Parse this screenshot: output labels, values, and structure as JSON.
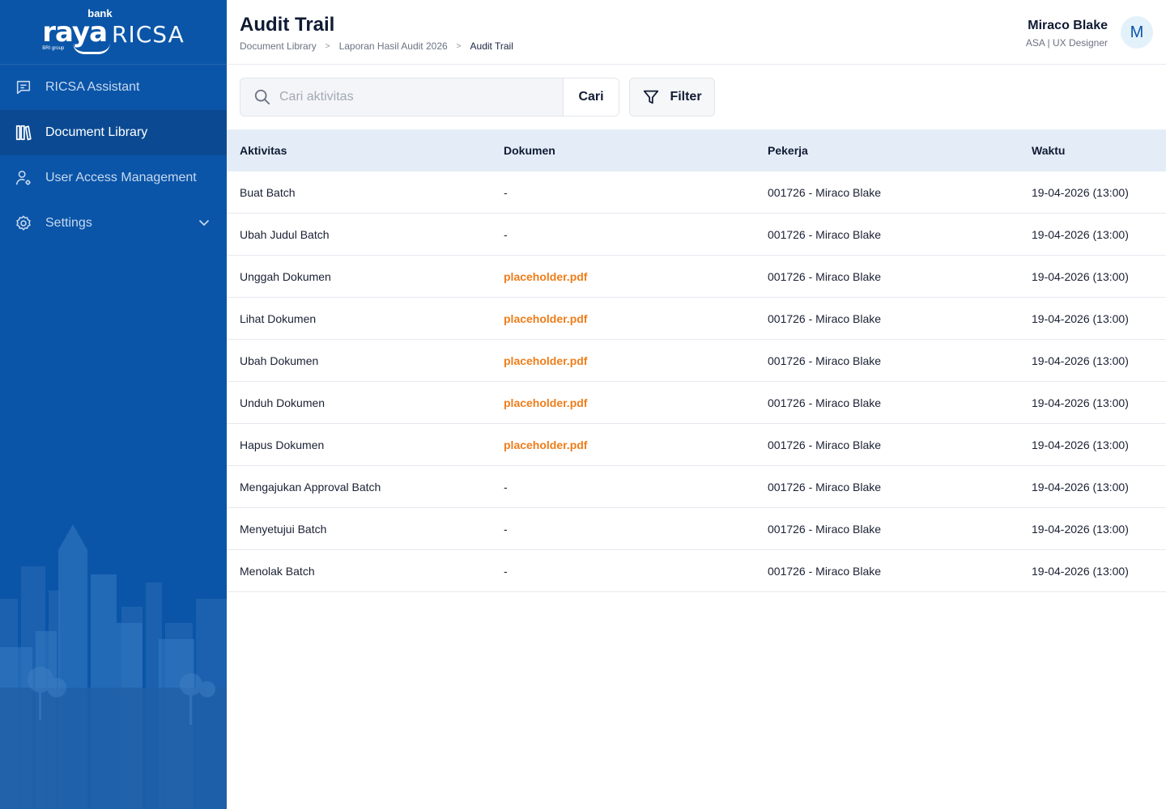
{
  "brand": {
    "logo_main": "raya",
    "logo_bank": "bank",
    "logo_group": "BRI group",
    "logo_product": "RICSA"
  },
  "sidebar": {
    "items": [
      {
        "label": "RICSA Assistant",
        "icon": "chat-icon",
        "active": false
      },
      {
        "label": "Document Library",
        "icon": "library-icon",
        "active": true
      },
      {
        "label": "User Access Management",
        "icon": "user-gear-icon",
        "active": false
      },
      {
        "label": "Settings",
        "icon": "gear-icon",
        "active": false,
        "expandable": true
      }
    ]
  },
  "header": {
    "title": "Audit Trail",
    "breadcrumb": [
      "Document Library",
      "Laporan Hasil Audit 2026",
      "Audit Trail"
    ],
    "breadcrumb_separator": ">",
    "user": {
      "name": "Miraco Blake",
      "role": "ASA | UX Designer",
      "initial": "M"
    }
  },
  "toolbar": {
    "search_placeholder": "Cari aktivitas",
    "search_value": "",
    "search_button": "Cari",
    "filter_button": "Filter"
  },
  "table": {
    "columns": [
      "Aktivitas",
      "Dokumen",
      "Pekerja",
      "Waktu"
    ],
    "rows": [
      {
        "aktivitas": "Buat Batch",
        "dokumen": "-",
        "pekerja": "001726 - Miraco Blake",
        "waktu": "19-04-2026 (13:00)"
      },
      {
        "aktivitas": "Ubah Judul Batch",
        "dokumen": "-",
        "pekerja": "001726 - Miraco Blake",
        "waktu": "19-04-2026 (13:00)"
      },
      {
        "aktivitas": "Unggah Dokumen",
        "dokumen": "placeholder.pdf",
        "pekerja": "001726 - Miraco Blake",
        "waktu": "19-04-2026 (13:00)"
      },
      {
        "aktivitas": "Lihat Dokumen",
        "dokumen": "placeholder.pdf",
        "pekerja": "001726 - Miraco Blake",
        "waktu": "19-04-2026 (13:00)"
      },
      {
        "aktivitas": "Ubah Dokumen",
        "dokumen": "placeholder.pdf",
        "pekerja": "001726 - Miraco Blake",
        "waktu": "19-04-2026 (13:00)"
      },
      {
        "aktivitas": "Unduh Dokumen",
        "dokumen": "placeholder.pdf",
        "pekerja": "001726 - Miraco Blake",
        "waktu": "19-04-2026 (13:00)"
      },
      {
        "aktivitas": "Hapus Dokumen",
        "dokumen": "placeholder.pdf",
        "pekerja": "001726 - Miraco Blake",
        "waktu": "19-04-2026 (13:00)"
      },
      {
        "aktivitas": "Mengajukan Approval Batch",
        "dokumen": "-",
        "pekerja": "001726 - Miraco Blake",
        "waktu": "19-04-2026 (13:00)"
      },
      {
        "aktivitas": "Menyetujui Batch",
        "dokumen": "-",
        "pekerja": "001726 - Miraco Blake",
        "waktu": "19-04-2026 (13:00)"
      },
      {
        "aktivitas": "Menolak Batch",
        "dokumen": "-",
        "pekerja": "001726 - Miraco Blake",
        "waktu": "19-04-2026 (13:00)"
      }
    ]
  },
  "colors": {
    "sidebar_bg": "#0a55a8",
    "sidebar_active": "#0b4a92",
    "table_header_bg": "#e4edf7",
    "link": "#ef7d1a",
    "avatar_bg": "#e3f1fb"
  }
}
